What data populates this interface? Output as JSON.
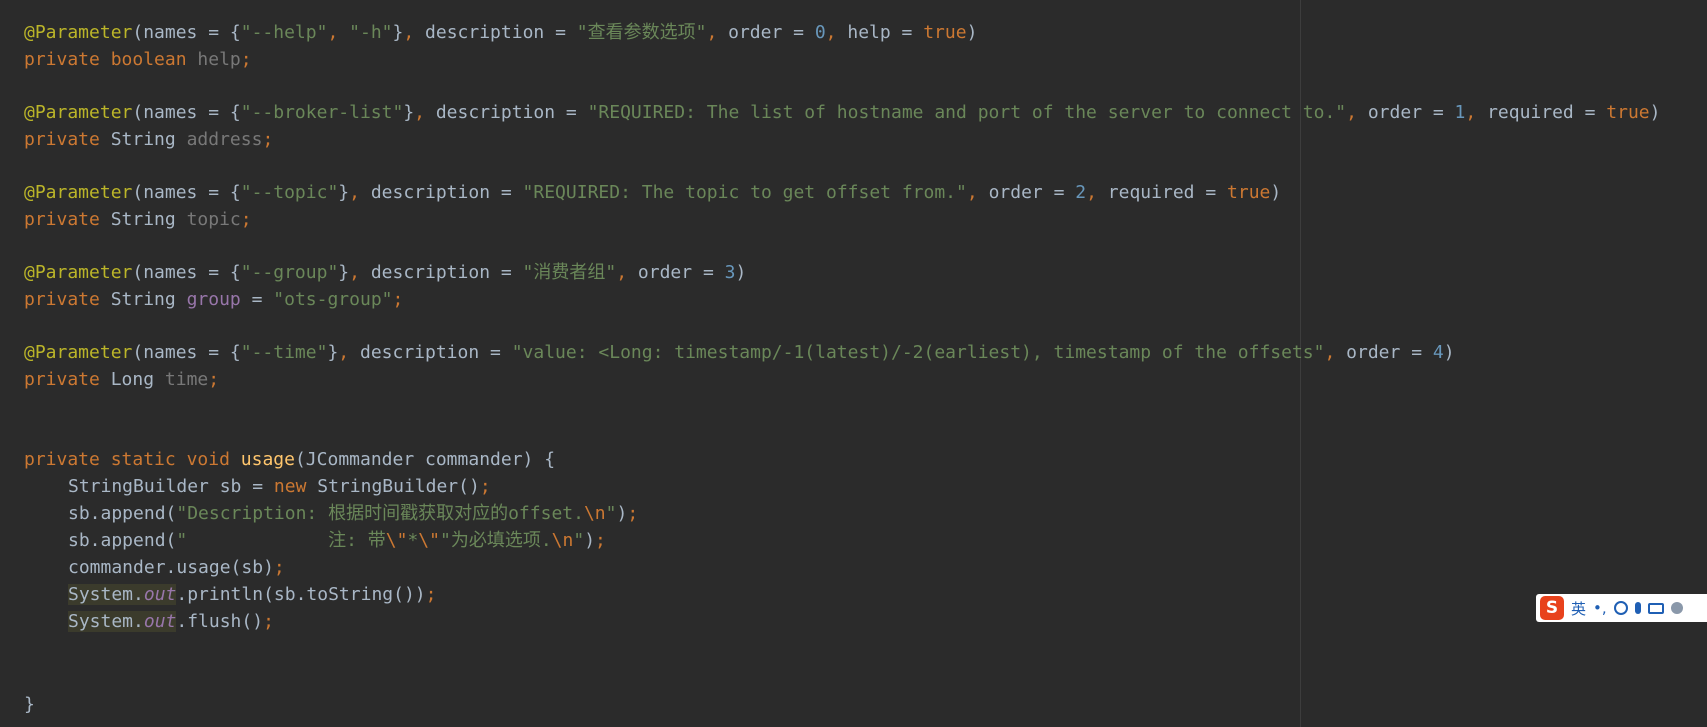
{
  "code": {
    "l1": {
      "ann": "@Parameter",
      "p_open": "(names = {",
      "s1": "\"--help\"",
      "comma1": ", ",
      "s2": "\"-h\"",
      "p_mid": "}",
      "comma2": ", ",
      "desc_key": "description = ",
      "desc_val": "\"查看参数选项\"",
      "comma3": ", ",
      "order_key": "order = ",
      "order_val": "0",
      "comma4": ", ",
      "help_key": "help = ",
      "help_val": "true",
      "close": ")"
    },
    "l2": {
      "kw1": "private",
      "kw2": "boolean",
      "field": "help",
      "semi": ";"
    },
    "l3": {
      "ann": "@Parameter",
      "p_open": "(names = {",
      "s1": "\"--broker-list\"",
      "p_mid": "}",
      "comma1": ", ",
      "desc_key": "description = ",
      "desc_val": "\"REQUIRED: The list of hostname and port of the server to connect to.\"",
      "comma2": ", ",
      "order_key": "order = ",
      "order_val": "1",
      "comma3": ", ",
      "req_key": "required = ",
      "req_val": "true",
      "close": ")"
    },
    "l4": {
      "kw1": "private",
      "type": "String",
      "field": "address",
      "semi": ";"
    },
    "l5": {
      "ann": "@Parameter",
      "p_open": "(names = {",
      "s1": "\"--topic\"",
      "p_mid": "}",
      "comma1": ", ",
      "desc_key": "description = ",
      "desc_val": "\"REQUIRED: The topic to get offset from.\"",
      "comma2": ", ",
      "order_key": "order = ",
      "order_val": "2",
      "comma3": ", ",
      "req_key": "required = ",
      "req_val": "true",
      "close": ")"
    },
    "l6": {
      "kw1": "private",
      "type": "String",
      "field": "topic",
      "semi": ";"
    },
    "l7": {
      "ann": "@Parameter",
      "p_open": "(names = {",
      "s1": "\"--group\"",
      "p_mid": "}",
      "comma1": ", ",
      "desc_key": "description = ",
      "desc_val": "\"消费者组\"",
      "comma2": ", ",
      "order_key": "order = ",
      "order_val": "3",
      "close": ")"
    },
    "l8": {
      "kw1": "private",
      "type": "String",
      "field": "group",
      "eq": " = ",
      "val": "\"ots-group\"",
      "semi": ";"
    },
    "l9": {
      "ann": "@Parameter",
      "p_open": "(names = {",
      "s1": "\"--time\"",
      "p_mid": "}",
      "comma1": ", ",
      "desc_key": "description = ",
      "desc_val": "\"value: <Long: timestamp/-1(latest)/-2(earliest), timestamp of the offsets\"",
      "comma2": ", ",
      "order_key": "order = ",
      "order_val": "4",
      "close": ")"
    },
    "l10": {
      "kw1": "private",
      "type": "Long",
      "field": "time",
      "semi": ";"
    },
    "l11": {
      "kw1": "private",
      "kw2": "static",
      "kw3": "void",
      "fn": "usage",
      "params": "(JCommander commander) {"
    },
    "l12": {
      "a": "StringBuilder sb = ",
      "kw": "new",
      "b": " StringBuilder()",
      "semi": ";"
    },
    "l13": {
      "a": "sb.append(",
      "str": "\"Description: 根据时间戳获取对应的offset.",
      "esc": "\\n",
      "str_end": "\"",
      "b": ")",
      "semi": ";"
    },
    "l14": {
      "a": "sb.append(",
      "str": "\"             注: 带",
      "esc1": "\\\"",
      "mid": "*",
      "esc2": "\\\"",
      "str2": "\"为必填选项.",
      "esc3": "\\n",
      "str_end": "\"",
      "b": ")",
      "semi": ";"
    },
    "l15": {
      "a": "commander.usage(sb)",
      "semi": ";"
    },
    "l16": {
      "sys": "System.",
      "out": "out",
      "b": ".println(sb.toString())",
      "semi": ";"
    },
    "l17": {
      "sys": "System.",
      "out": "out",
      "b": ".flush()",
      "semi": ";"
    },
    "l18": {
      "brace": "}"
    }
  },
  "ime": {
    "logo": "S",
    "lang": "英",
    "punct": "•,"
  }
}
